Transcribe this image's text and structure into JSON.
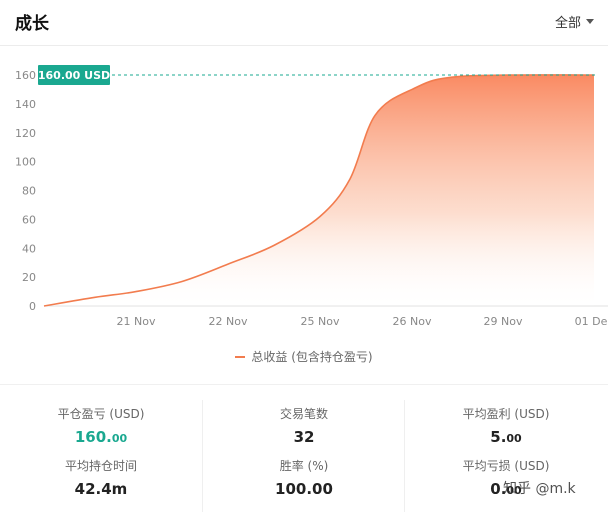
{
  "header": {
    "title": "成长",
    "filter_label": "全部"
  },
  "chart_data": {
    "type": "area",
    "x_ticks": [
      "21 Nov",
      "22 Nov",
      "25 Nov",
      "26 Nov",
      "29 Nov",
      "01 Dec"
    ],
    "x": [
      "20 Nov",
      "20 Nov",
      "21 Nov",
      "21 Nov",
      "22 Nov",
      "22 Nov",
      "25 Nov",
      "25 Nov",
      "26 Nov",
      "26 Nov",
      "29 Nov",
      "01 Dec"
    ],
    "series": [
      {
        "name": "总收益 (包含持仓盈亏)",
        "values": [
          0,
          6,
          10,
          17,
          29,
          42,
          62,
          88,
          132,
          150,
          159,
          160
        ],
        "color": "#f27c4e"
      }
    ],
    "ylim": [
      0,
      160
    ],
    "y_ticks": [
      "0",
      "20",
      "40",
      "60",
      "80",
      "100",
      "120",
      "140",
      "160"
    ],
    "reference_line": {
      "value": 160,
      "label": "160.00 USD",
      "color": "#1aa890"
    },
    "grid": false,
    "legend_position": "bottom"
  },
  "legend": {
    "label": "总收益 (包含持仓盈亏)"
  },
  "stats": [
    {
      "label": "平仓盈亏 (USD)",
      "value_main": "160.",
      "value_dec": "00",
      "color": "#1aa890"
    },
    {
      "label": "交易笔数",
      "value_main": "32",
      "value_dec": ""
    },
    {
      "label": "平均盈利 (USD)",
      "value_main": "5.",
      "value_dec": "00"
    },
    {
      "label": "平均持仓时间",
      "value_main": "42.4m",
      "value_dec": ""
    },
    {
      "label": "胜率 (%)",
      "value_main": "100.00",
      "value_dec": ""
    },
    {
      "label": "平均亏损 (USD)",
      "value_main": "0.",
      "value_dec": "00"
    }
  ],
  "watermark": "知乎 @m.k"
}
